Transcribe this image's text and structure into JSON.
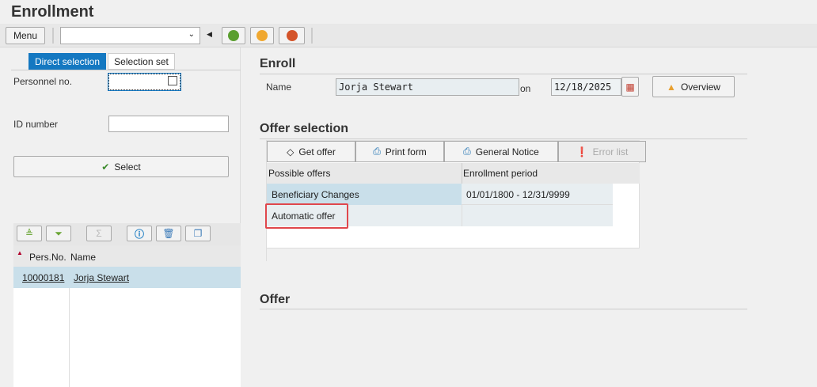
{
  "window": {
    "title": "Enrollment"
  },
  "toolbar": {
    "menu_label": "Menu",
    "command_value": ""
  },
  "left": {
    "tabs": [
      "Direct selection",
      "Selection set"
    ],
    "personnel_label": "Personnel no.",
    "personnel_value": "",
    "id_label": "ID number",
    "id_value": "",
    "select_label": "Select",
    "list_headers": [
      "Pers.No.",
      "Name"
    ],
    "rows": [
      {
        "pers_no": "10000181",
        "name": "Jorja Stewart"
      }
    ]
  },
  "enroll": {
    "title": "Enroll",
    "name_label": "Name",
    "name_value": "Jorja Stewart",
    "on_label": "on",
    "date_value": "12/18/2025",
    "overview_label": "Overview"
  },
  "offer_selection": {
    "title": "Offer selection",
    "buttons": [
      "Get offer",
      "Print form",
      "General Notice",
      "Error list"
    ],
    "headers": [
      "Possible offers",
      "Enrollment period"
    ],
    "rows": [
      {
        "offer": "Beneficiary Changes",
        "period": "01/01/1800 - 12/31/9999"
      },
      {
        "offer": "Automatic offer",
        "period": ""
      }
    ]
  },
  "offer": {
    "title": "Offer"
  }
}
